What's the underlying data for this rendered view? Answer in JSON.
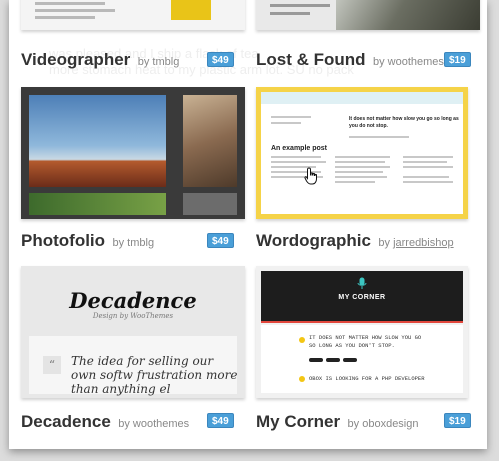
{
  "themes": [
    {
      "id": "videographer",
      "name": "Videographer",
      "by_prefix": "by",
      "author": "tmblg",
      "price": "$49"
    },
    {
      "id": "lost-and-found",
      "name": "Lost & Found",
      "by_prefix": "by",
      "author": "woothemes",
      "price": "$19"
    },
    {
      "id": "photofolio",
      "name": "Photofolio",
      "by_prefix": "by",
      "author": "tmblg",
      "price": "$49"
    },
    {
      "id": "wordographic",
      "name": "Wordographic",
      "by_prefix": "by",
      "author": "jarredbishop",
      "price": "$19"
    },
    {
      "id": "decadence",
      "name": "Decadence",
      "by_prefix": "by",
      "author": "woothemes",
      "price": "$49"
    },
    {
      "id": "my-corner",
      "name": "My Corner",
      "by_prefix": "by",
      "author": "oboxdesign",
      "price": "$19"
    }
  ],
  "thumbs": {
    "wordographic": {
      "heading": "An example post",
      "quote": "It does not matter how slow you go so long as you do not stop."
    },
    "decadence": {
      "logo": "Decadence",
      "tagline": "Design by WooThemes",
      "quote": "The idea for selling our own softw frustration more than anything el"
    },
    "my_corner": {
      "title": "MY CORNER",
      "quote1": "IT DOES NOT MATTER HOW SLOW YOU GO SO LONG AS YOU DON'T STOP.",
      "quote2": "OBOX IS LOOKING FOR A PHP DEVELOPER"
    }
  },
  "colors": {
    "price_badge": "#4a9fd8",
    "wordographic_border": "#f5d348",
    "my_corner_accent": "#e2473d"
  },
  "icons": {
    "cursor": "hand-pointer-icon",
    "my_corner_logo": "microphone-icon",
    "decadence_quote": "quote-icon"
  }
}
